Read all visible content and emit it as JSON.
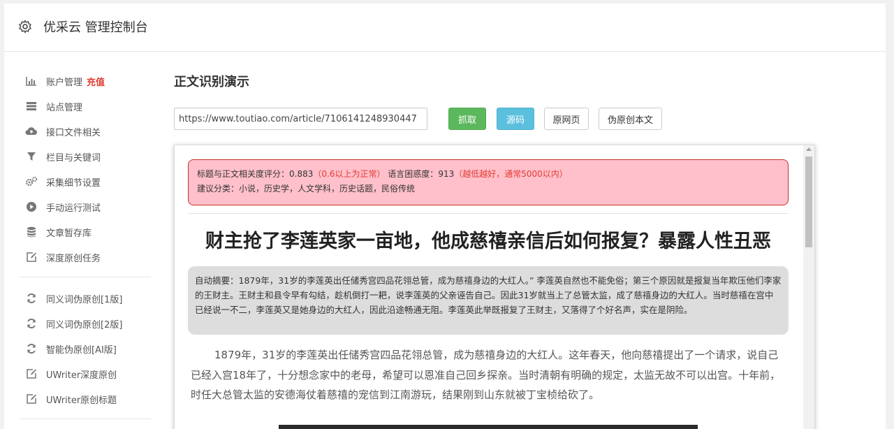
{
  "header": {
    "brand": "优采云 管理控制台"
  },
  "sidebar": {
    "items": [
      {
        "label": "账户管理",
        "badge": "充值",
        "icon": "bar-chart-icon"
      },
      {
        "label": "站点管理",
        "icon": "server-icon"
      },
      {
        "label": "接口文件相关",
        "icon": "cloud-upload-icon"
      },
      {
        "label": "栏目与关键词",
        "icon": "filter-icon"
      },
      {
        "label": "采集细节设置",
        "icon": "cogs-icon"
      },
      {
        "label": "手动运行测试",
        "icon": "play-circle-icon"
      },
      {
        "label": "文章暂存库",
        "icon": "database-icon"
      },
      {
        "label": "深度原创任务",
        "icon": "edit-icon"
      }
    ],
    "items2": [
      {
        "label": "同义词伪原创[1版]",
        "icon": "refresh-icon"
      },
      {
        "label": "同义词伪原创[2版]",
        "icon": "refresh-icon"
      },
      {
        "label": "智能伪原创[AI版]",
        "icon": "refresh-icon"
      },
      {
        "label": "UWriter深度原创",
        "icon": "edit-icon"
      },
      {
        "label": "UWriter原创标题",
        "icon": "edit-icon"
      }
    ]
  },
  "main": {
    "title": "正文识别演示",
    "url_value": "https://www.toutiao.com/article/7106141248930447",
    "buttons": {
      "fetch": "抓取",
      "source": "源码",
      "original": "原网页",
      "rewrite": "伪原创本文"
    }
  },
  "result": {
    "score_label": "标题与正文相关度评分：",
    "score_value": "0.883",
    "score_note": "（0.6以上为正常）",
    "perplexity_label": "语言困惑度：",
    "perplexity_value": "913",
    "perplexity_note": "（越低越好，通常5000以内）",
    "category_label": "建议分类：",
    "category_value": "小说，历史学，人文学科，历史话题，民俗传统",
    "article_title": "财主抢了李莲英家一亩地，他成慈禧亲信后如何报复？暴露人性丑恶",
    "summary": "自动摘要：1879年，31岁的李莲英出任储秀宫四品花翎总管，成为慈禧身边的大红人。” 李莲英自然也不能免俗；第三个原因就是报复当年欺压他们李家的王财主。王财主和县令早有勾结，趁机倒打一耙，说李莲英的父亲诬告自己。因此31岁就当上了总管太监，成了慈禧身边的大红人。当时慈禧在宫中已经说一不二，李莲英又是她身边的大红人，因此沿途畅通无阻。李莲英此举既报复了王财主，又落得了个好名声，实在是阴险。",
    "body": "1879年，31岁的李莲英出任储秀宫四品花翎总管，成为慈禧身边的大红人。这年春天，他向慈禧提出了一个请求，说自己已经入宫18年了，十分想念家中的老母，希望可以恩准自己回乡探亲。当时清朝有明确的规定，太监无故不可以出宫。十年前，时任大总管太监的安德海仗着慈禧的宠信到江南游玩，结果刚到山东就被丁宝桢给砍了。"
  }
}
